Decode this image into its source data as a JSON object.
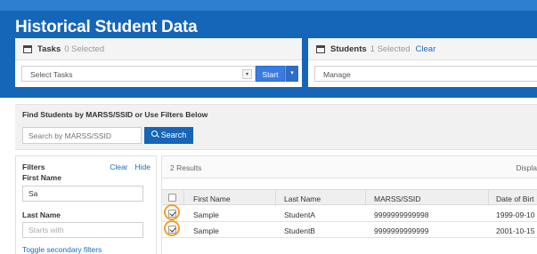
{
  "app": {
    "title": "Historical Student Data"
  },
  "tasks_panel": {
    "title": "Tasks",
    "count": "0 Selected",
    "select_value": "Select Tasks",
    "start_label": "Start",
    "caret": "▾"
  },
  "students_panel": {
    "title": "Students",
    "count": "1 Selected",
    "clear_label": "Clear",
    "select_value": "Manage"
  },
  "find": {
    "label": "Find Students by MARSS/SSID or Use Filters Below",
    "search_placeholder": "Search by MARSS/SSID",
    "search_button": "Search"
  },
  "filters": {
    "title": "Filters",
    "clear_label": "Clear",
    "hide_label": "Hide",
    "first_name_label": "First Name",
    "first_name_value": "Sa",
    "last_name_label": "Last Name",
    "last_name_placeholder": "Starts with",
    "toggle_label": "Toggle secondary filters"
  },
  "results": {
    "count_text": "2 Results",
    "display_text": "Displa",
    "columns": [
      "First Name",
      "Last Name",
      "MARSS/SSID",
      "Date of Birt"
    ],
    "rows": [
      {
        "checked": true,
        "first_name": "Sample",
        "last_name": "StudentA",
        "id": "9999999999998",
        "dob": "1999-09-10"
      },
      {
        "checked": true,
        "first_name": "Sample",
        "last_name": "StudentB",
        "id": "9999999999999",
        "dob": "2001-10-15"
      }
    ]
  },
  "colors": {
    "header_blue": "#1565b8",
    "button_blue": "#3a7be0",
    "link_blue": "#1a6bc6",
    "highlight_ring": "#f0a030"
  }
}
